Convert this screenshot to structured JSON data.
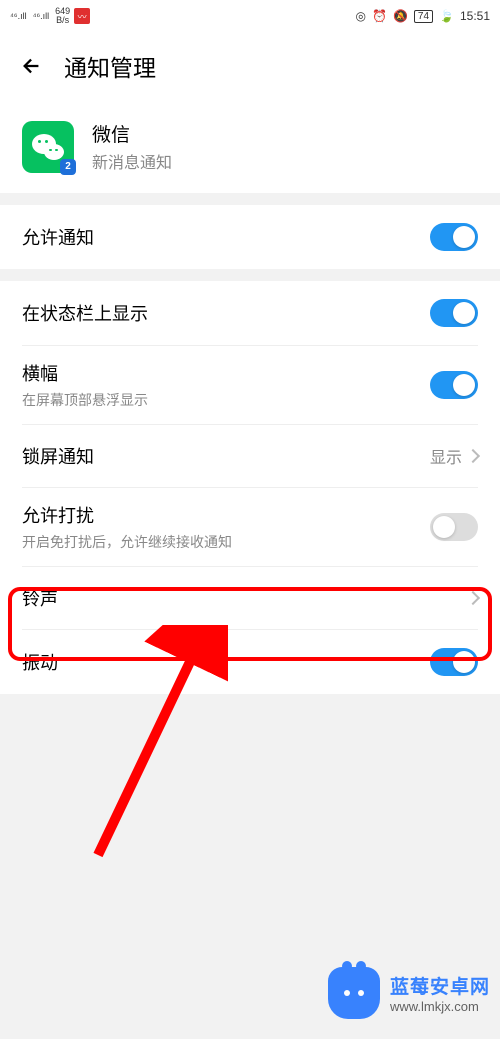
{
  "status": {
    "signal1": "46",
    "signal2": "46",
    "speed_num": "649",
    "speed_unit": "B/s",
    "battery": "74",
    "time": "15:51"
  },
  "header": {
    "title": "通知管理"
  },
  "app": {
    "name": "微信",
    "sub": "新消息通知",
    "badge": "2"
  },
  "settings": {
    "allow_notif": {
      "label": "允许通知",
      "on": true
    },
    "status_bar": {
      "label": "在状态栏上显示",
      "on": true
    },
    "banner": {
      "label": "横幅",
      "desc": "在屏幕顶部悬浮显示",
      "on": true
    },
    "lockscreen": {
      "label": "锁屏通知",
      "value": "显示"
    },
    "dnd": {
      "label": "允许打扰",
      "desc": "开启免打扰后，允许继续接收通知",
      "on": false
    },
    "ringtone": {
      "label": "铃声"
    },
    "vibrate": {
      "label": "振动",
      "on": true
    }
  },
  "watermark": {
    "title": "蓝莓安卓网",
    "url": "www.lmkjx.com"
  }
}
